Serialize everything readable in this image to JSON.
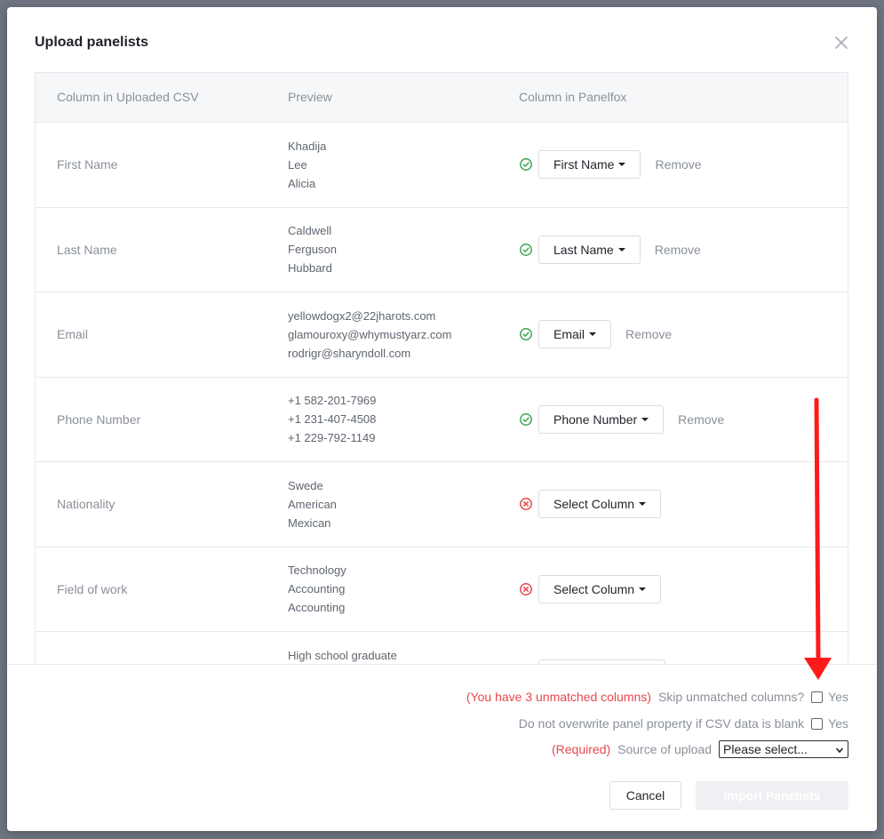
{
  "modal": {
    "title": "Upload panelists"
  },
  "table": {
    "headers": [
      "Column in Uploaded CSV",
      "Preview",
      "Column in Panelfox"
    ],
    "rows": [
      {
        "name": "First Name",
        "preview": [
          "Khadija",
          "Lee",
          "Alicia"
        ],
        "status": "matched",
        "mapping": "First Name",
        "remove": "Remove"
      },
      {
        "name": "Last Name",
        "preview": [
          "Caldwell",
          "Ferguson",
          "Hubbard"
        ],
        "status": "matched",
        "mapping": "Last Name",
        "remove": "Remove"
      },
      {
        "name": "Email",
        "preview": [
          "yellowdogx2@22jharots.com",
          "glamouroxy@whymustyarz.com",
          "rodrigr@sharyndoll.com"
        ],
        "status": "matched",
        "mapping": "Email",
        "remove": "Remove"
      },
      {
        "name": "Phone Number",
        "preview": [
          "+1 582-201-7969",
          "+1 231-407-4508",
          "+1 229-792-1149"
        ],
        "status": "matched",
        "mapping": "Phone Number",
        "remove": "Remove"
      },
      {
        "name": "Nationality",
        "preview": [
          "Swede",
          "American",
          "Mexican"
        ],
        "status": "unmatched",
        "mapping": "Select Column",
        "remove": ""
      },
      {
        "name": "Field of work",
        "preview": [
          "Technology",
          "Accounting",
          "Accounting"
        ],
        "status": "unmatched",
        "mapping": "Select Column",
        "remove": ""
      },
      {
        "name": "",
        "preview": [
          "High school graduate"
        ],
        "status": "unmatched",
        "mapping": "",
        "remove": ""
      }
    ]
  },
  "footer": {
    "unmatched_warning": "(You have 3 unmatched columns)",
    "skip_label": "Skip unmatched columns?",
    "skip_yes": "Yes",
    "overwrite_label": "Do not overwrite panel property if CSV data is blank",
    "overwrite_yes": "Yes",
    "required_label": "(Required)",
    "source_label": "Source of upload",
    "source_value": "Please select...",
    "cancel_label": "Cancel",
    "import_label": "Import Panelists"
  },
  "colors": {
    "matched": "#3aa655",
    "unmatched": "#e5484d",
    "annotation_arrow": "#ff1a1a"
  },
  "icons": {
    "close": "close-icon",
    "matched": "check-circle-icon",
    "unmatched": "x-circle-icon"
  }
}
